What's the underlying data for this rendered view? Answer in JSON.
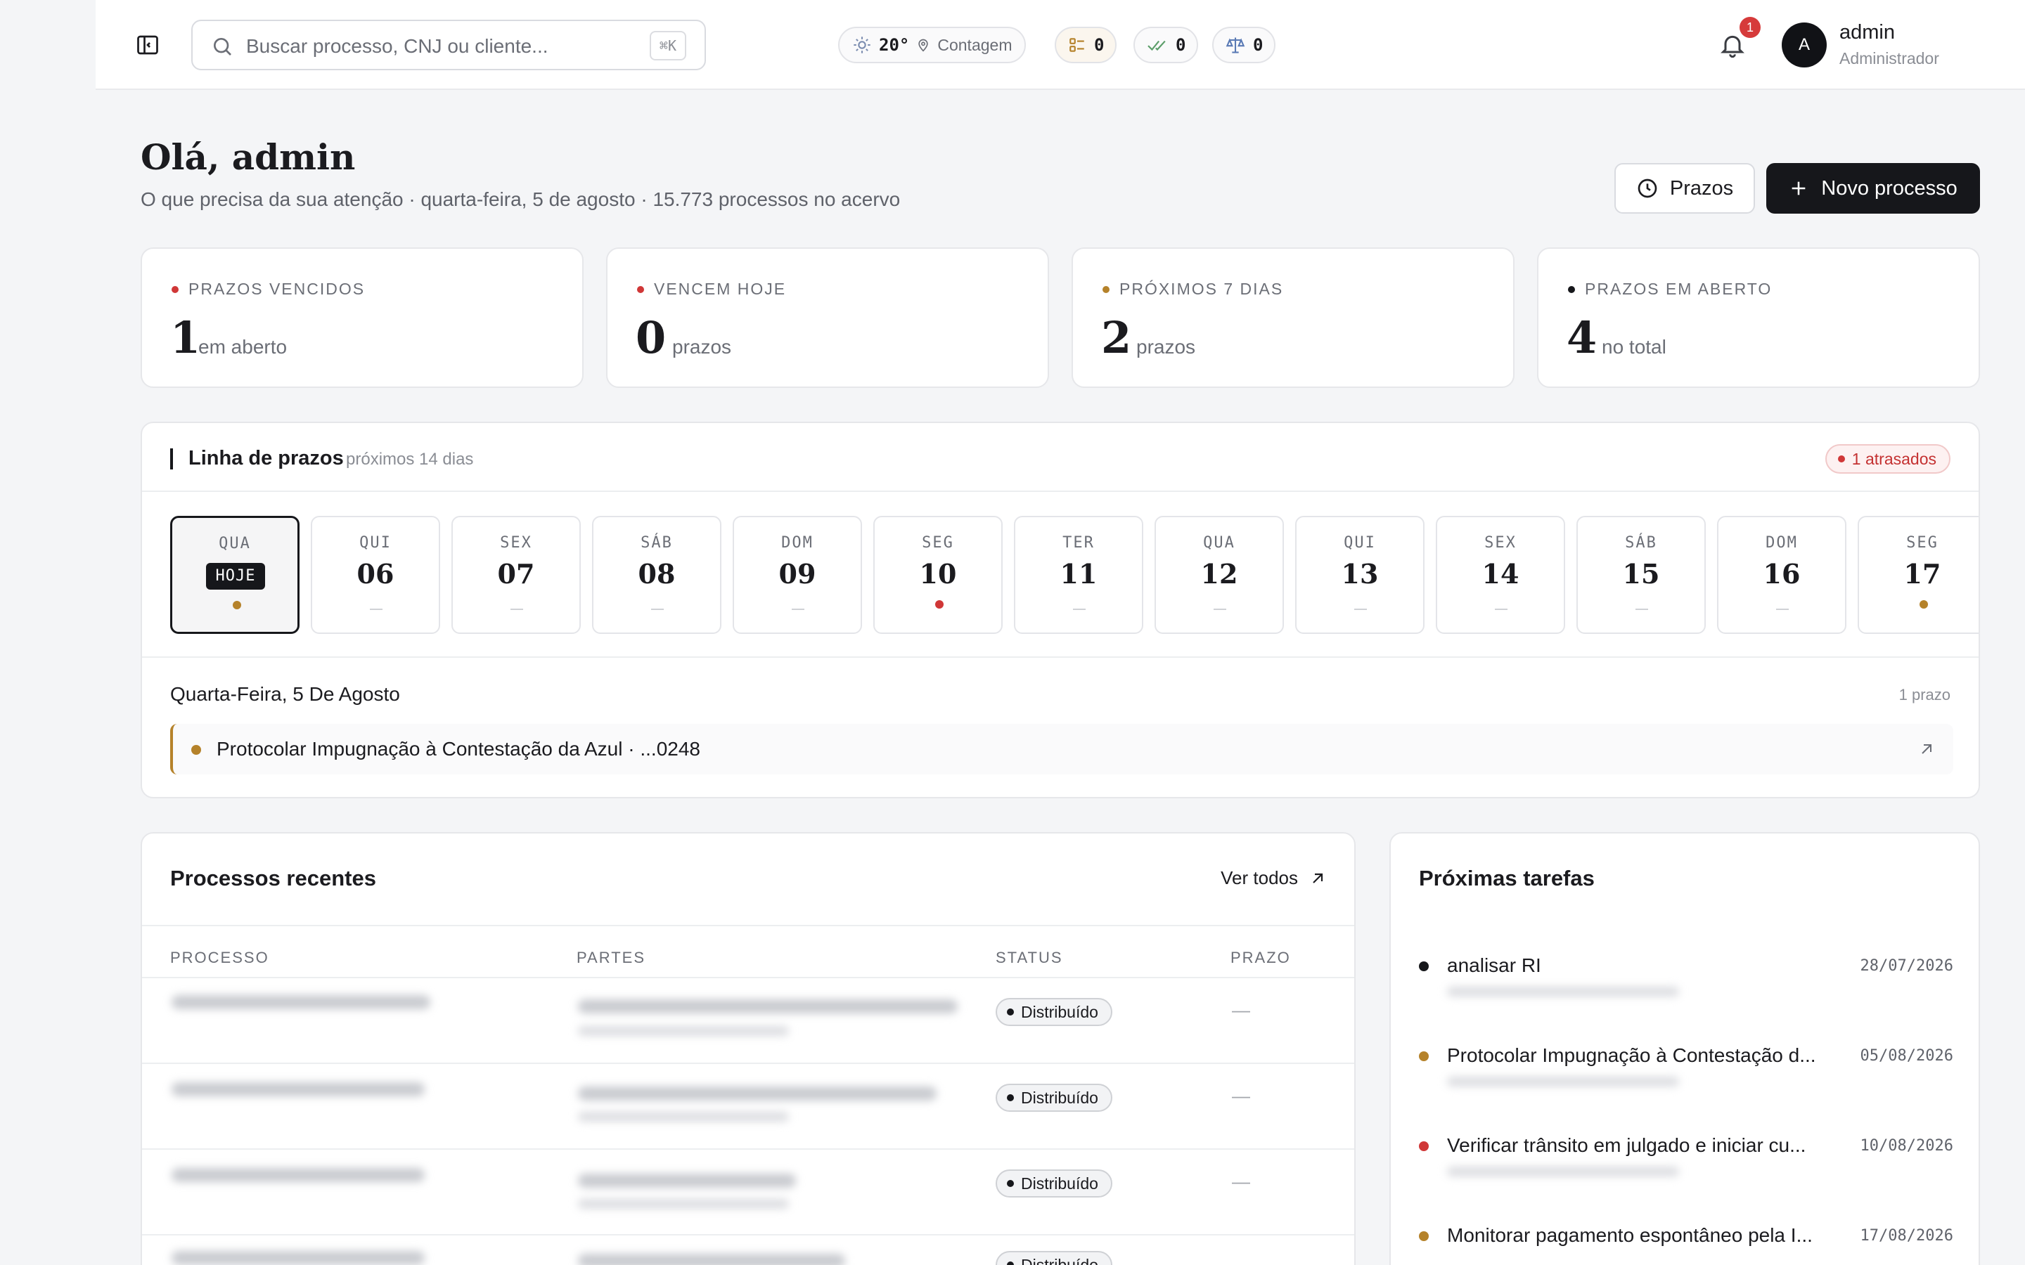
{
  "colors": {
    "red": "#d03737",
    "amber": "#b5822a",
    "dark": "#16171b"
  },
  "topbar": {
    "search_placeholder": "Buscar processo, CNJ ou cliente...",
    "search_shortcut": "⌘K",
    "weather": {
      "temp": "20°",
      "city": "Contagem"
    },
    "counters": [
      {
        "icon": "task-list-icon",
        "value": "0"
      },
      {
        "icon": "double-check-icon",
        "value": "0"
      },
      {
        "icon": "scale-icon",
        "value": "0"
      }
    ],
    "notifications_count": "1",
    "user": {
      "initial": "A",
      "name": "admin",
      "role": "Administrador"
    }
  },
  "header": {
    "greeting": "Olá, admin",
    "subtitle": "O que precisa da sua atenção · quarta-feira, 5 de agosto · 15.773 processos no acervo",
    "prazos_button": "Prazos",
    "novo_button": "Novo processo"
  },
  "stats": [
    {
      "label": "PRAZOS VENCIDOS",
      "value": "1",
      "unit": "em aberto",
      "color": "#d03737"
    },
    {
      "label": "VENCEM HOJE",
      "value": "0",
      "unit": "prazos",
      "color": "#d03737"
    },
    {
      "label": "PRÓXIMOS 7 DIAS",
      "value": "2",
      "unit": "prazos",
      "color": "#b5822a"
    },
    {
      "label": "PRAZOS EM ABERTO",
      "value": "4",
      "unit": "no total",
      "color": "#16171b"
    }
  ],
  "timeline": {
    "title": "Linha de prazos",
    "subtitle": "próximos 14 dias",
    "overdue_badge": "1 atrasados",
    "days": [
      {
        "weekday": "QUA",
        "day": "HOJE",
        "today": true,
        "marker": "#b5822a"
      },
      {
        "weekday": "QUI",
        "day": "06",
        "marker": ""
      },
      {
        "weekday": "SEX",
        "day": "07",
        "marker": ""
      },
      {
        "weekday": "SÁB",
        "day": "08",
        "marker": ""
      },
      {
        "weekday": "DOM",
        "day": "09",
        "marker": ""
      },
      {
        "weekday": "SEG",
        "day": "10",
        "marker": "#d03737"
      },
      {
        "weekday": "TER",
        "day": "11",
        "marker": ""
      },
      {
        "weekday": "QUA",
        "day": "12",
        "marker": ""
      },
      {
        "weekday": "QUI",
        "day": "13",
        "marker": ""
      },
      {
        "weekday": "SEX",
        "day": "14",
        "marker": ""
      },
      {
        "weekday": "SÁB",
        "day": "15",
        "marker": ""
      },
      {
        "weekday": "DOM",
        "day": "16",
        "marker": ""
      },
      {
        "weekday": "SEG",
        "day": "17",
        "marker": "#b5822a"
      }
    ],
    "selected_date": "Quarta-Feira, 5 De Agosto",
    "selected_count": "1 prazo",
    "item": "Protocolar Impugnação à Contestação da Azul · ...0248"
  },
  "recent": {
    "title": "Processos recentes",
    "link": "Ver todos",
    "columns": [
      "PROCESSO",
      "PARTES",
      "STATUS",
      "PRAZO"
    ],
    "rows": [
      {
        "status": "Distribuído",
        "prazo": "—"
      },
      {
        "status": "Distribuído",
        "prazo": "—"
      },
      {
        "status": "Distribuído",
        "prazo": "—"
      },
      {
        "status": "Distribuído",
        "prazo": ""
      }
    ]
  },
  "tasks": {
    "title": "Próximas tarefas",
    "items": [
      {
        "title": "analisar RI",
        "date": "28/07/2026",
        "color": "#16171b"
      },
      {
        "title": "Protocolar Impugnação à Contestação d...",
        "date": "05/08/2026",
        "color": "#b5822a"
      },
      {
        "title": "Verificar trânsito em julgado e iniciar cu...",
        "date": "10/08/2026",
        "color": "#d03737"
      },
      {
        "title": "Monitorar pagamento espontâneo pela I...",
        "date": "17/08/2026",
        "color": "#b5822a"
      }
    ]
  }
}
